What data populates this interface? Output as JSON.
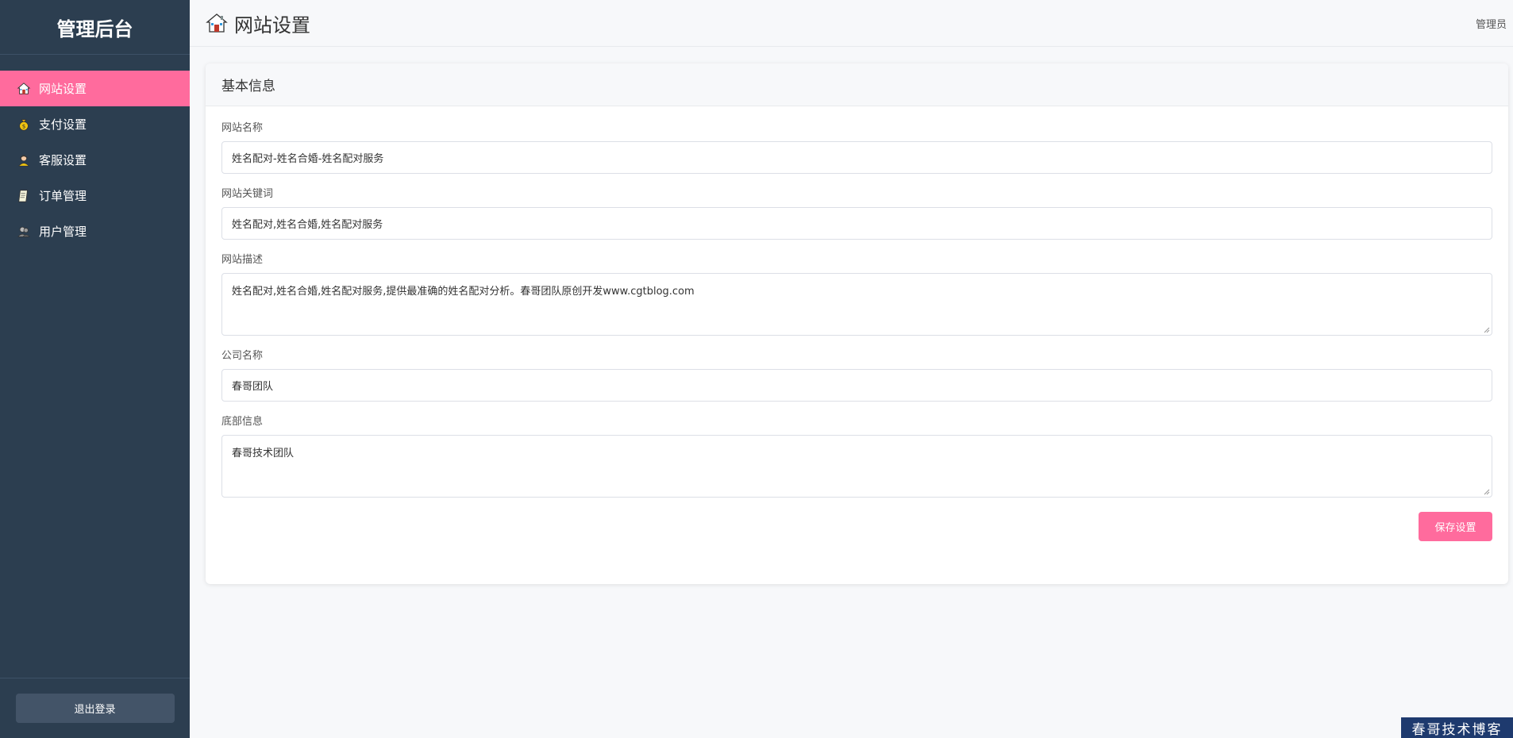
{
  "sidebar": {
    "title": "管理后台",
    "items": [
      {
        "label": "网站设置",
        "icon": "house-icon",
        "active": true
      },
      {
        "label": "支付设置",
        "icon": "money-bag-icon",
        "active": false
      },
      {
        "label": "客服设置",
        "icon": "support-agent-icon",
        "active": false
      },
      {
        "label": "订单管理",
        "icon": "document-icon",
        "active": false
      },
      {
        "label": "用户管理",
        "icon": "users-icon",
        "active": false
      }
    ],
    "logout_label": "退出登录"
  },
  "header": {
    "title": "网站设置",
    "icon": "house-icon",
    "user_label": "管理员"
  },
  "card": {
    "title": "基本信息",
    "fields": {
      "site_name": {
        "label": "网站名称",
        "value": "姓名配对-姓名合婚-姓名配对服务"
      },
      "site_keywords": {
        "label": "网站关键词",
        "value": "姓名配对,姓名合婚,姓名配对服务"
      },
      "site_description": {
        "label": "网站描述",
        "value": "姓名配对,姓名合婚,姓名配对服务,提供最准确的姓名配对分析。春哥团队原创开发www.cgtblog.com"
      },
      "company_name": {
        "label": "公司名称",
        "value": "春哥团队"
      },
      "footer_info": {
        "label": "底部信息",
        "value": "春哥技术团队"
      }
    },
    "save_label": "保存设置"
  },
  "watermark": "春哥技术博客",
  "colors": {
    "sidebar_bg": "#2c3e50",
    "accent": "#ff6b9d",
    "page_bg": "#f7f8fa"
  }
}
